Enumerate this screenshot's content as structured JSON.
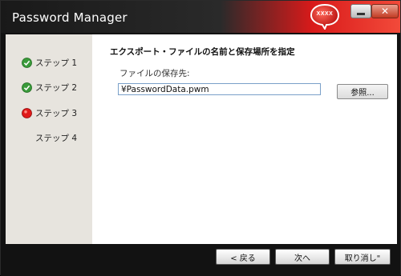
{
  "window": {
    "title": "Password Manager"
  },
  "logo": {
    "text": "XXXX"
  },
  "sidebar": {
    "steps": [
      {
        "label": "ステップ 1",
        "status": "done",
        "icon": "check-icon"
      },
      {
        "label": "ステップ 2",
        "status": "done",
        "icon": "check-icon"
      },
      {
        "label": "ステップ 3",
        "status": "current",
        "icon": "red-dot-icon"
      },
      {
        "label": "ステップ 4",
        "status": "pending",
        "icon": ""
      }
    ]
  },
  "main": {
    "heading": "エクスポート・ファイルの名前と保存場所を指定",
    "save_label": "ファイルの保存先:",
    "save_path": "¥PasswordData.pwm",
    "browse_label": "参照..."
  },
  "footer": {
    "back_label": "< 戻る",
    "next_label": "次へ",
    "cancel_label": "取り消し\""
  },
  "colors": {
    "accent_red": "#d91a1a",
    "check_green": "#3a9a3a",
    "sidebar_bg": "#e7e4de"
  }
}
